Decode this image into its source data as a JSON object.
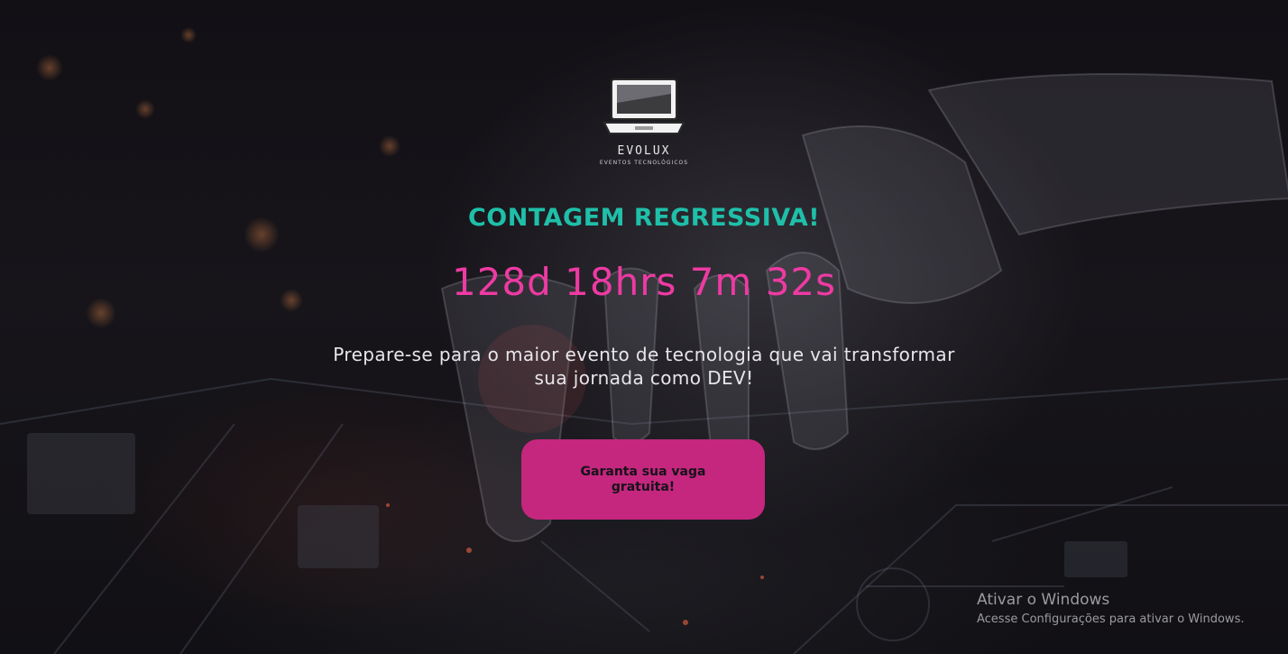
{
  "logo": {
    "icon": "laptop-icon",
    "name": "EVOLUX",
    "subtitle": "EVENTOS TECNOLÓGICOS"
  },
  "headline": "CONTAGEM REGRESSIVA!",
  "countdown": "128d 18hrs 7m 32s",
  "tagline": "Prepare-se para o maior evento de tecnologia que vai transformar sua jornada como DEV!",
  "cta": {
    "label": "Garanta sua vaga gratuita!"
  },
  "watermark": {
    "title": "Ativar o Windows",
    "subtitle": "Acesse Configurações para ativar o Windows."
  },
  "colors": {
    "headline": "#1fbfa9",
    "countdown": "#ee3aa3",
    "cta_background": "#c4277d"
  }
}
